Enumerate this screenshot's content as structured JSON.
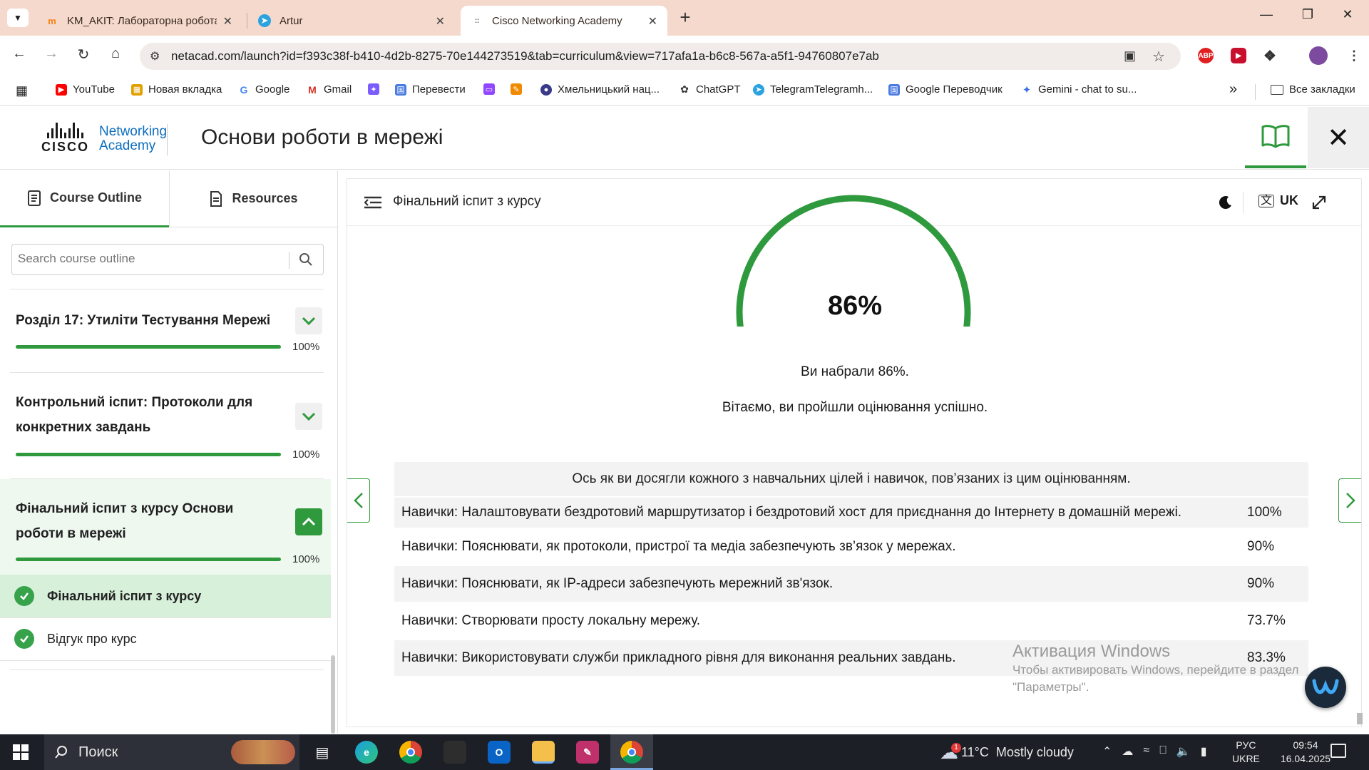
{
  "browser": {
    "tabs": [
      {
        "title": "KM_AKIT: Лабораторна робота",
        "icon": "moodle-icon"
      },
      {
        "title": "Artur",
        "icon": "telegram-icon"
      },
      {
        "title": "Cisco Networking Academy",
        "icon": "cisco-icon",
        "active": true
      }
    ],
    "url": "netacad.com/launch?id=f393c38f-b410-4d2b-8275-70e144273519&tab=curriculum&view=717afa1a-b6c8-567a-a5f1-94760807e7ab",
    "bookmarks": [
      {
        "label": "YouTube",
        "icon": "youtube-icon",
        "color": "#ff0000"
      },
      {
        "label": "Новая вкладка",
        "icon": "apps-grid-icon",
        "color": "#e0a000"
      },
      {
        "label": "Google",
        "icon": "google-icon",
        "color": "#4285f4"
      },
      {
        "label": "Gmail",
        "icon": "gmail-icon",
        "color": "#d93025"
      },
      {
        "label": "",
        "icon": "ai-icon",
        "color": "#7b5cff"
      },
      {
        "label": "Перевести",
        "icon": "translate-icon",
        "color": "#4a7be0"
      },
      {
        "label": "",
        "icon": "twitch-icon",
        "color": "#9146ff"
      },
      {
        "label": "",
        "icon": "pencil-icon",
        "color": "#f08a00"
      },
      {
        "label": "Хмельницький нац...",
        "icon": "university-icon",
        "color": "#3a3a8a"
      },
      {
        "label": "ChatGPT",
        "icon": "chatgpt-icon",
        "color": "#333333"
      },
      {
        "label": "TelegramTelegramh...",
        "icon": "telegram-icon",
        "color": "#2aa3e0"
      },
      {
        "label": "Google Переводчик",
        "icon": "translate-icon",
        "color": "#4a7be0"
      },
      {
        "label": "Gemini - chat to su...",
        "icon": "gemini-icon",
        "color": "#3a6ee8"
      }
    ],
    "all_bookmarks_label": "Все закладки",
    "overflow_label": "»"
  },
  "header": {
    "logo_word": "CISCO",
    "logo_line1": "Networking",
    "logo_line2": "Academy",
    "course_title": "Основи роботи в мережі"
  },
  "sidebar": {
    "tabs": [
      {
        "label": "Course Outline"
      },
      {
        "label": "Resources"
      }
    ],
    "search_placeholder": "Search course outline",
    "sections": [
      {
        "title": "Розділ 17: Утиліти Тестування Мережі",
        "progress_pct": 100,
        "progress_label": "100%",
        "expanded": false
      },
      {
        "title": "Контрольний іспит: Протоколи для конкретних завдань",
        "progress_pct": 100,
        "progress_label": "100%",
        "expanded": false
      },
      {
        "title": "Фінальний іспит з курсу Основи роботи в мережі",
        "progress_pct": 100,
        "progress_label": "100%",
        "expanded": true
      }
    ],
    "items": [
      {
        "label": "Фінальний іспит з курсу",
        "status": "complete",
        "active": true
      },
      {
        "label": "Відгук про курс",
        "status": "complete",
        "active": false
      }
    ]
  },
  "main": {
    "title": "Фінальний іспит з курсу",
    "language": "UK",
    "score_value": 86,
    "score_label": "86%",
    "score_text": "Ви набрали 86%.",
    "success_text": "Вітаємо, ви пройшли оцінювання успішно.",
    "skills_header": "Ось як ви досягли кожного з навчальних цілей і навичок, пов’язаних із цим оцінюванням.",
    "skills": [
      {
        "label": "Навички: Налаштовувати бездротовий маршрутизатор і бездротовий хост для приєднання до Інтернету в домашній мережі.",
        "pct": "100%"
      },
      {
        "label": "Навички: Пояснювати, як протоколи, пристрої та медіа забезпечують зв’язок у мережах.",
        "pct": "90%"
      },
      {
        "label": "Навички: Пояснювати, як IP-адреси забезпечують мережний зв'язок.",
        "pct": "90%"
      },
      {
        "label": "Навички: Створювати просту локальну мережу.",
        "pct": "73.7%"
      },
      {
        "label": "Навички: Використовувати служби прикладного рівня для виконання реальних завдань.",
        "pct": "83.3%"
      }
    ]
  },
  "watermark": {
    "line1": "Активация Windows",
    "line2": "Чтобы активировать Windows, перейдите в раздел",
    "line3": "\"Параметры\"."
  },
  "taskbar": {
    "search_label": "Поиск",
    "weather_temp": "11°C",
    "weather_desc": "Mostly cloudy",
    "weather_badge": "1",
    "lang1": "РУС",
    "lang2": "UKRE",
    "time": "09:54",
    "date": "16.04.2025"
  },
  "colors": {
    "accent_green": "#2f9a3d",
    "tabstrip": "#f4d9cc",
    "cisco_blue": "#0d6ebd"
  }
}
